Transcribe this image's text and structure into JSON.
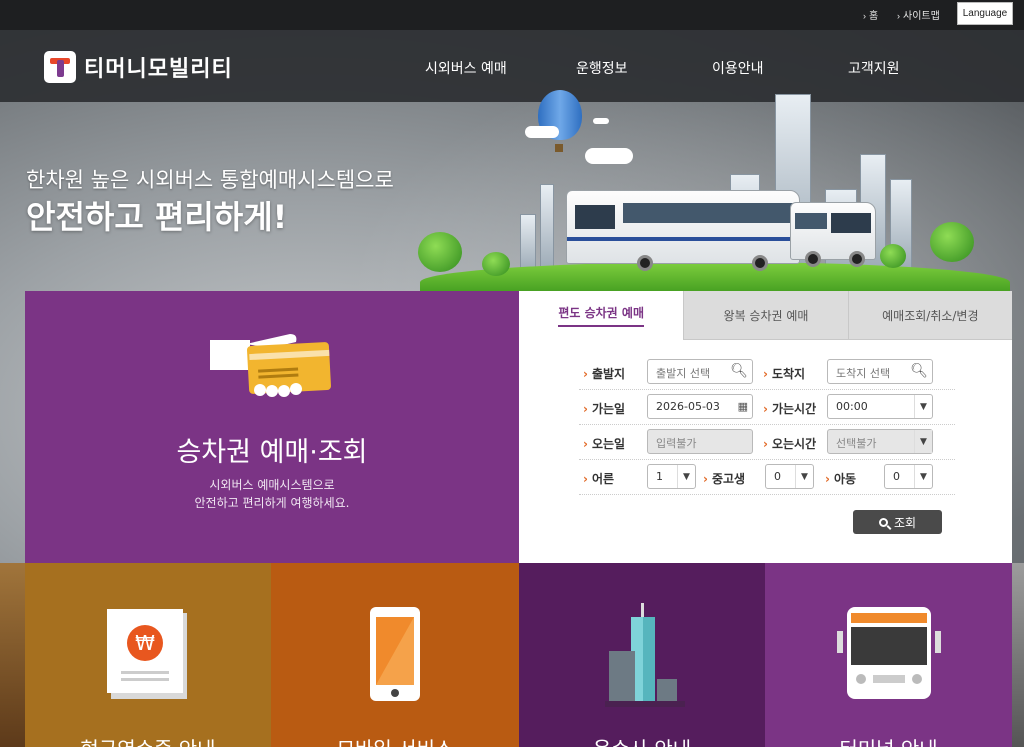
{
  "util_bar": {
    "home_label": "홈",
    "sitemap_label": "사이트맵",
    "language_label": "Language"
  },
  "header": {
    "logo_text": "티머니모빌리티",
    "nav": [
      "시외버스 예매",
      "운행정보",
      "이용안내",
      "고객지원"
    ]
  },
  "hero": {
    "subtitle": "한차원 높은 시외버스 통합예매시스템으로",
    "title": "안전하고 편리하게!"
  },
  "reservation": {
    "title": "승차권 예매·조회",
    "desc_line1": "시외버스 예매시스템으로",
    "desc_line2": "안전하고 편리하게 여행하세요.",
    "tabs": [
      "편도 승차권 예매",
      "왕복 승차권 예매",
      "예매조회/취소/변경"
    ],
    "active_tab": 0,
    "form": {
      "departure_label": "출발지",
      "departure_placeholder": "출발지 선택",
      "arrival_label": "도착지",
      "arrival_placeholder": "도착지 선택",
      "depart_date_label": "가는일",
      "depart_date_value": "2026-05-03",
      "depart_time_label": "가는시간",
      "depart_time_value": "00:00",
      "return_date_label": "오는일",
      "return_date_value": "입력불가",
      "return_time_label": "오는시간",
      "return_time_value": "선택불가",
      "adult_label": "어른",
      "adult_value": "1",
      "teen_label": "중고생",
      "teen_value": "0",
      "child_label": "아동",
      "child_value": "0",
      "search_label": "조회"
    }
  },
  "tiles": [
    {
      "label": "현금영수증 안내",
      "color": "#a6701f",
      "icon": "receipt-won-icon"
    },
    {
      "label": "모바일 서비스",
      "color": "#b95b12",
      "icon": "mobile-phone-icon"
    },
    {
      "label": "운수사 안내",
      "color": "#551d5d",
      "icon": "building-icon"
    },
    {
      "label": "터미널 안내",
      "color": "#7b3485",
      "icon": "bus-front-icon"
    }
  ],
  "colors": {
    "brand_purple": "#7b3485",
    "accent_orange": "#e26c2a",
    "header_dark": "#2d2f32"
  }
}
